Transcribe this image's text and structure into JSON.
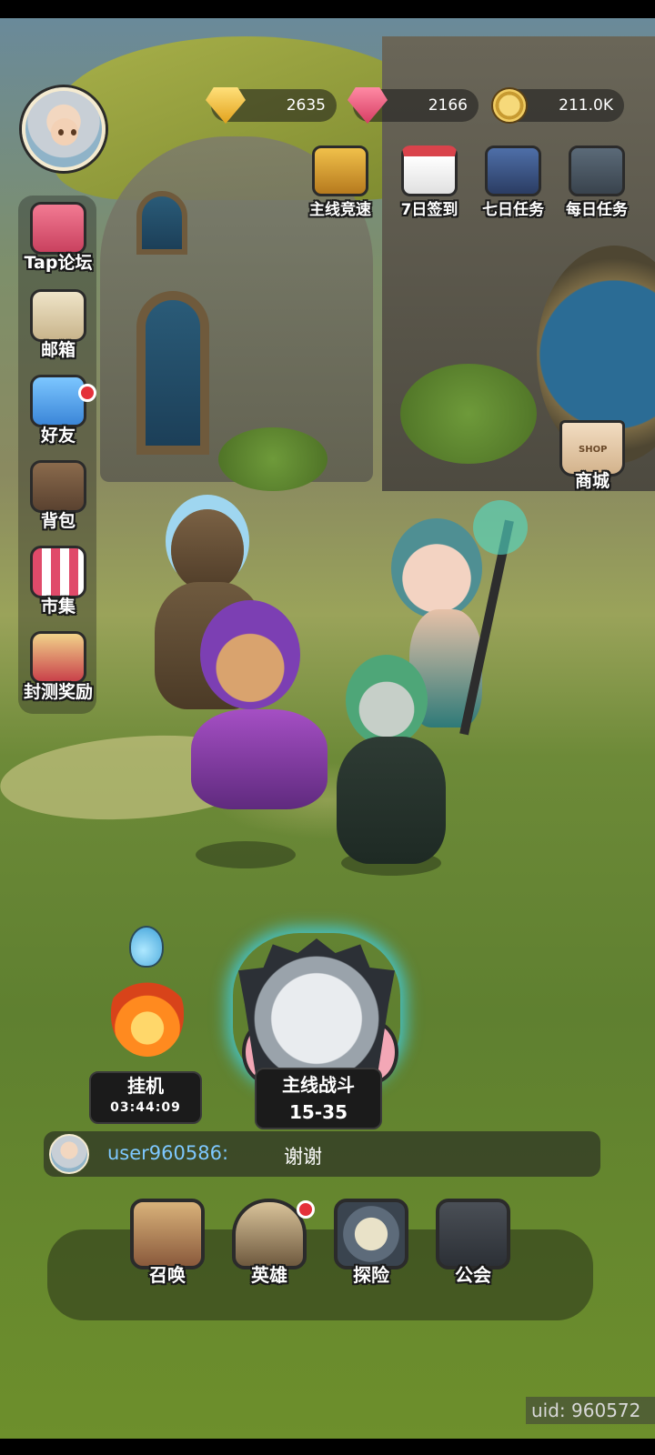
{
  "currencies": [
    {
      "icon": "gold-diamond-icon",
      "value": "2635"
    },
    {
      "icon": "pink-gem-icon",
      "value": "2166"
    },
    {
      "icon": "gold-coin-icon",
      "value": "211.0K"
    }
  ],
  "top_events": [
    {
      "icon": "trophy-icon",
      "label": "主线竞速"
    },
    {
      "icon": "calendar-icon",
      "label": "7日签到"
    },
    {
      "icon": "helmet-icon",
      "label": "七日任务"
    },
    {
      "icon": "task-board-icon",
      "label": "每日任务"
    }
  ],
  "sidebar": [
    {
      "icon": "chat-bubble-icon",
      "label": "Tap论坛"
    },
    {
      "icon": "envelope-icon",
      "label": "邮箱"
    },
    {
      "icon": "friends-icon",
      "label": "好友",
      "badge": true
    },
    {
      "icon": "backpack-icon",
      "label": "背包"
    },
    {
      "icon": "market-stall-icon",
      "label": "市集"
    },
    {
      "icon": "gift-icon",
      "label": "封测奖励"
    }
  ],
  "shop": {
    "label": "商城",
    "tag": "SHOP"
  },
  "idle": {
    "label": "挂机",
    "timer": "03:44:09"
  },
  "main_battle": {
    "label": "主线战斗",
    "stage": "15-35"
  },
  "chat": {
    "user": "user960586:",
    "message": "谢谢"
  },
  "bottom_nav": [
    {
      "icon": "summon-helmet-icon",
      "label": "召唤"
    },
    {
      "icon": "hero-crest-icon",
      "label": "英雄",
      "badge": true
    },
    {
      "icon": "compass-icon",
      "label": "探险"
    },
    {
      "icon": "guild-star-icon",
      "label": "公会"
    }
  ],
  "uid": "uid: 960572",
  "colors": {
    "accent_glow": "#30d5ff",
    "badge_red": "#e4313a",
    "chat_user": "#7ec8ff"
  }
}
